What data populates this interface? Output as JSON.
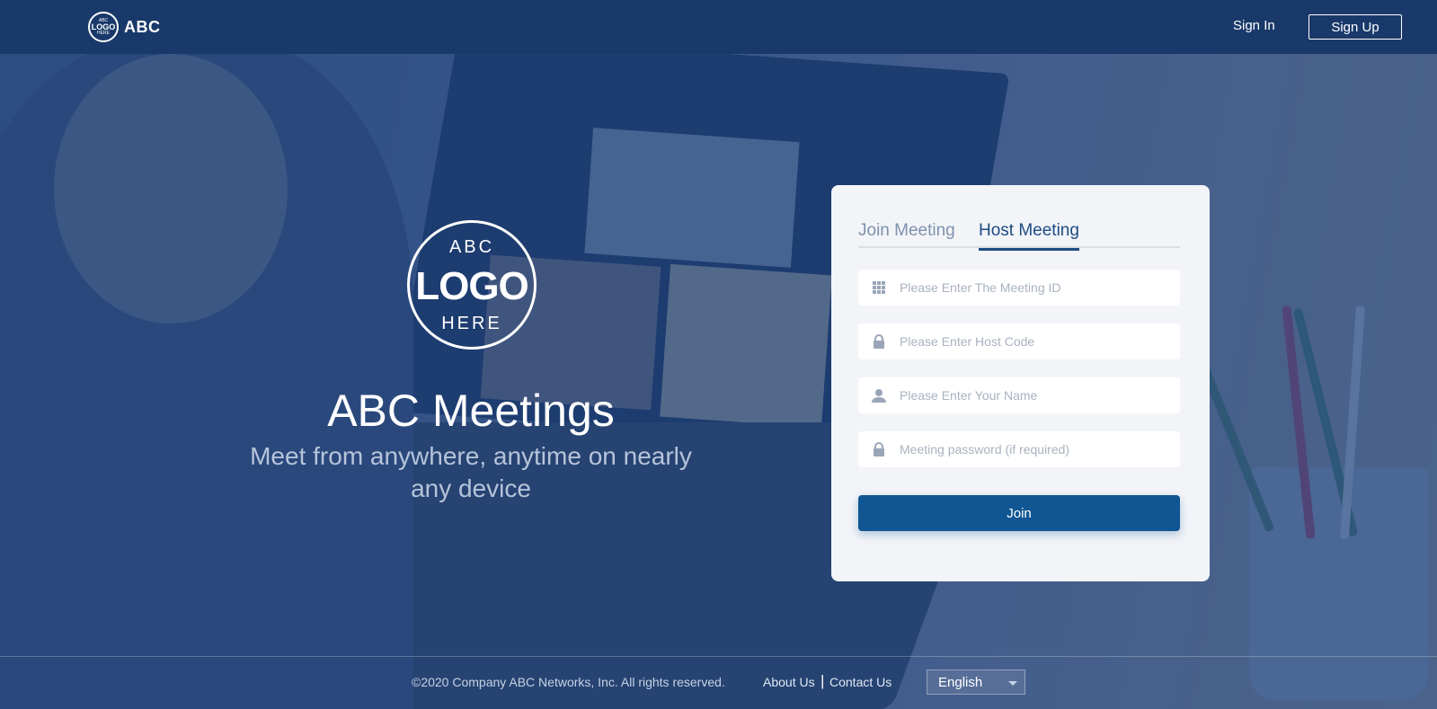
{
  "header": {
    "brand": {
      "logo_top": "ABC",
      "logo_mid": "LOGO",
      "logo_bottom": "HERE",
      "name": "ABC"
    },
    "sign_in": "Sign In",
    "sign_up": "Sign Up"
  },
  "hero": {
    "logo_top": "ABC",
    "logo_mid": "LOGO",
    "logo_bottom": "HERE",
    "title": "ABC Meetings",
    "subtitle": "Meet from anywhere, anytime on nearly any device"
  },
  "card": {
    "tabs": [
      {
        "label": "Join Meeting",
        "active": false
      },
      {
        "label": "Host Meeting",
        "active": true
      }
    ],
    "fields": [
      {
        "icon": "grid-icon",
        "placeholder": "Please Enter The Meeting ID",
        "value": ""
      },
      {
        "icon": "lock-icon",
        "placeholder": "Please Enter Host Code",
        "value": ""
      },
      {
        "icon": "user-icon",
        "placeholder": "Please Enter Your Name",
        "value": ""
      },
      {
        "icon": "lock-icon",
        "placeholder": "Meeting password (if required)",
        "value": ""
      }
    ],
    "join_label": "Join"
  },
  "footer": {
    "copyright": "©2020 Company ABC Networks, Inc. All rights reserved.",
    "about": "About Us",
    "separator": "|",
    "contact": "Contact Us",
    "language": "English"
  },
  "colors": {
    "header_bg": "#19396a",
    "overlay": "#1a4387",
    "primary_button": "#0f5693",
    "active_tab": "#1d4b82",
    "inactive_tab": "#7e92ad",
    "card_bg": "#f2f4f8"
  }
}
